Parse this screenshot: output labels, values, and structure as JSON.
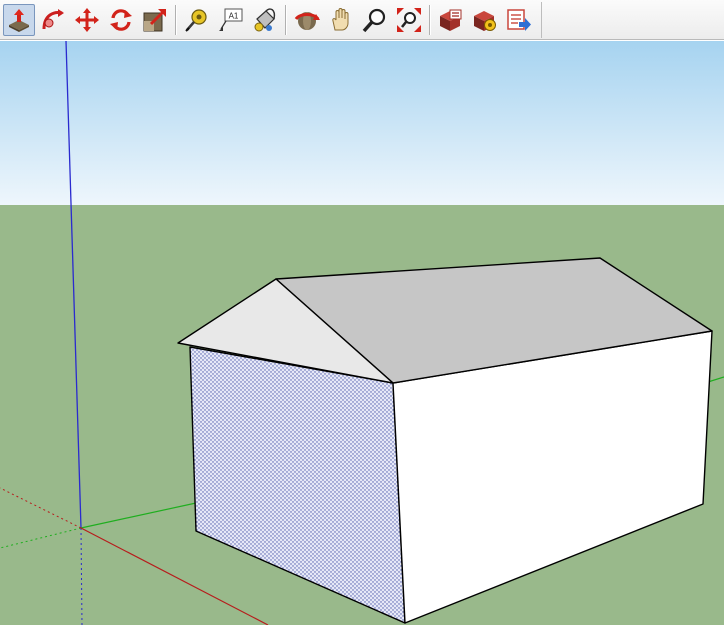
{
  "toolbar": {
    "tools": [
      {
        "id": "push-pull",
        "icon": "push-pull-icon",
        "active": true
      },
      {
        "id": "follow-me",
        "icon": "follow-me-icon"
      },
      {
        "id": "move",
        "icon": "move-icon"
      },
      {
        "id": "rotate",
        "icon": "rotate-icon"
      },
      {
        "id": "scale",
        "icon": "scale-icon"
      },
      {
        "id": "tape-measure",
        "icon": "tape-measure-icon"
      },
      {
        "id": "text",
        "icon": "text-icon",
        "label": "A1"
      },
      {
        "id": "paint-bucket",
        "icon": "paint-bucket-icon"
      },
      {
        "id": "orbit",
        "icon": "orbit-icon"
      },
      {
        "id": "pan",
        "icon": "pan-icon"
      },
      {
        "id": "zoom",
        "icon": "zoom-icon"
      },
      {
        "id": "zoom-extents",
        "icon": "zoom-extents-icon"
      },
      {
        "id": "get-models",
        "icon": "3d-warehouse-icon"
      },
      {
        "id": "components",
        "icon": "components-icon"
      },
      {
        "id": "share-model",
        "icon": "share-model-icon"
      }
    ]
  },
  "scene": {
    "sky_color": "#a6d3f0",
    "horizon_color": "#eef6fc",
    "ground_color": "#99b98b",
    "roof_front_color": "#e8e8e8",
    "roof_side_color": "#c6c6c6",
    "wall_front_color": "#ffffff",
    "wall_gable_color": "#e6e8f7",
    "axis_blue": "#2a2acf",
    "axis_red": "#b71c1c",
    "axis_green": "#1fae1f"
  }
}
